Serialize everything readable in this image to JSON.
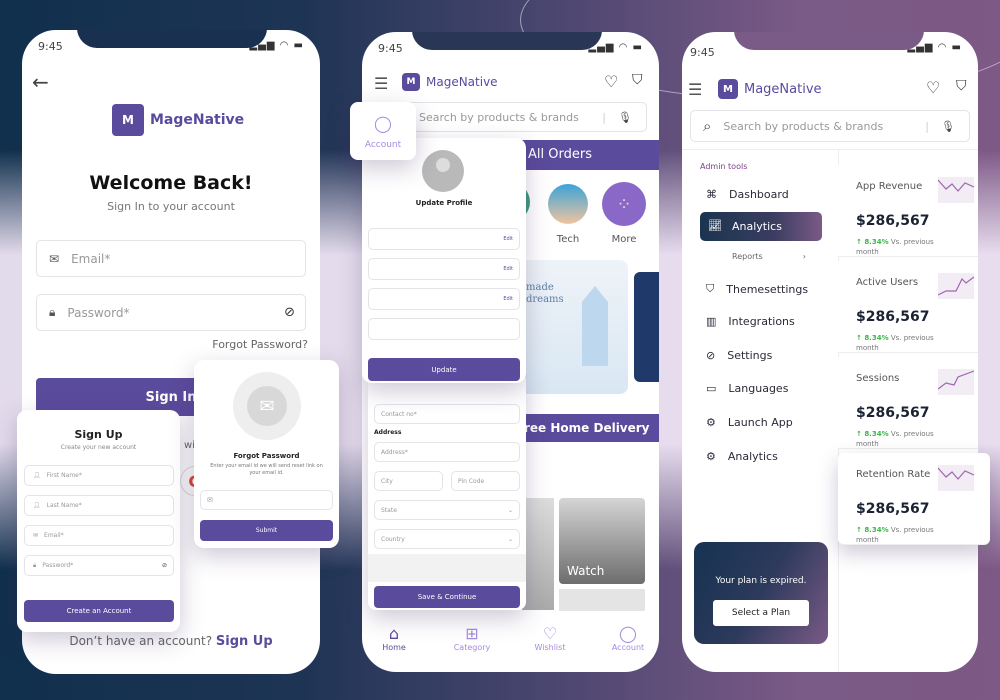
{
  "status_time": "9:45",
  "brand": "MageNative",
  "brand_color": "#5b4b9c",
  "login": {
    "title": "Welcome Back!",
    "subtitle": "Sign In to your account",
    "email_placeholder": "Email*",
    "password_placeholder": "Password*",
    "forgot": "Forgot Password?",
    "signin": "Sign In",
    "or_text": "wi",
    "no_account": "Don’t have an account?",
    "signup_link": "Sign Up"
  },
  "signup": {
    "title": "Sign Up",
    "subtitle": "Create your new account",
    "first_name": "First Name*",
    "last_name": "Last Name*",
    "email": "Email*",
    "password": "Password*",
    "button": "Create an Account"
  },
  "forgot": {
    "title": "Forgot Password",
    "desc": "Enter your email id we will send reset link on your email id.",
    "button": "Submit"
  },
  "shop": {
    "search_placeholder": "Search by products & brands",
    "orders_banner": "All Orders",
    "categories": [
      {
        "label": "Tech"
      },
      {
        "label": "More"
      }
    ],
    "banner_text": "made dreams",
    "delivery_banner": "ree Home Delivery",
    "tiles": [
      {
        "label": "Watch"
      }
    ],
    "bottom_nav": [
      {
        "label": "Home"
      },
      {
        "label": "Category"
      },
      {
        "label": "Wishlist"
      },
      {
        "label": "Account"
      }
    ]
  },
  "account_popup": {
    "label": "Account"
  },
  "profile": {
    "title": "Update Profile",
    "edit": "Edit",
    "update": "Update",
    "contact": "Contact no*",
    "address_heading": "Address",
    "address": "Address*",
    "city": "City",
    "pin": "Pin Code",
    "state": "State",
    "country": "Country",
    "save": "Save & Continue"
  },
  "admin": {
    "search_placeholder": "Search by products & brands",
    "section": "Admin tools",
    "menu": [
      {
        "label": "Dashboard"
      },
      {
        "label": "Analytics"
      },
      {
        "label": "Reports"
      },
      {
        "label": "Themesettings"
      },
      {
        "label": "Integrations"
      },
      {
        "label": "Settings"
      },
      {
        "label": "Languages"
      },
      {
        "label": "Launch App"
      },
      {
        "label": "Analytics"
      }
    ],
    "plan_text": "Your plan is expired.",
    "plan_button": "Select a Plan",
    "stats": [
      {
        "title": "App Revenue",
        "value": "$286,567",
        "change": "8.34%",
        "note": "Vs. previous month"
      },
      {
        "title": "Active Users",
        "value": "$286,567",
        "change": "8.34%",
        "note": "Vs. previous month"
      },
      {
        "title": "Sessions",
        "value": "$286,567",
        "change": "8.34%",
        "note": "Vs. previous month"
      },
      {
        "title": "Retention Rate",
        "value": "$286,567",
        "change": "8.34%",
        "note": "Vs. previous month"
      }
    ]
  }
}
